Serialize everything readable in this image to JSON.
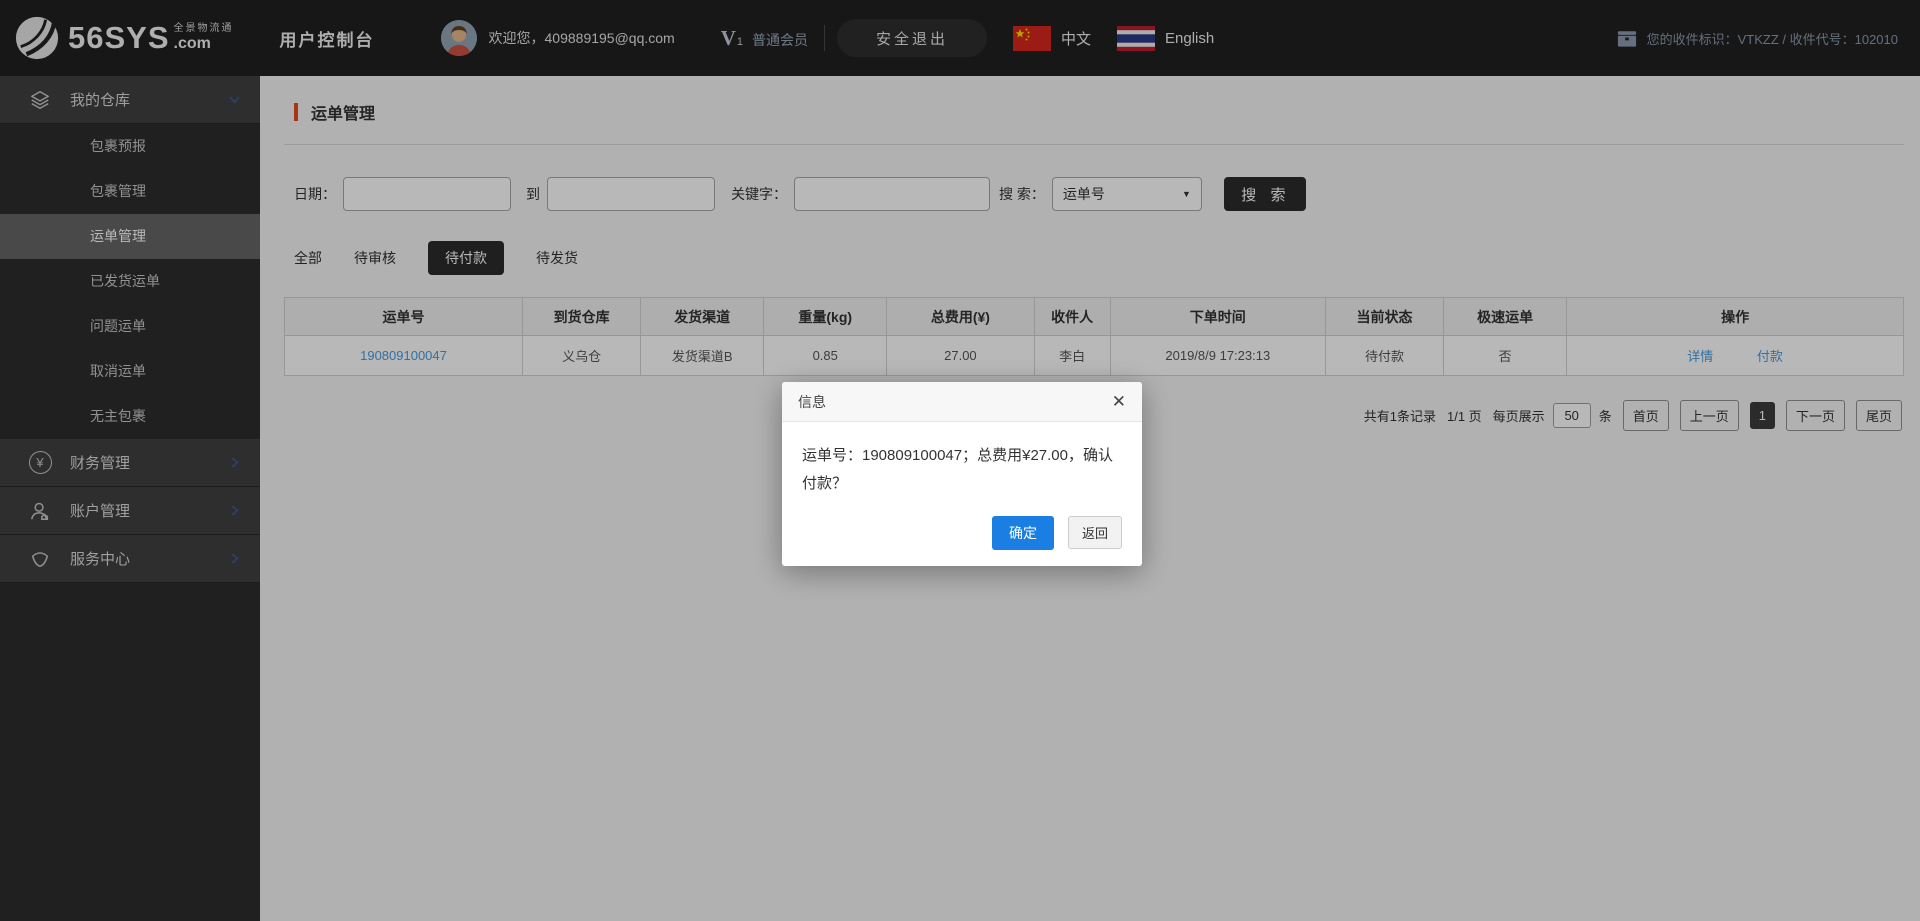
{
  "brand": {
    "name_main": "56SYS",
    "name_suffix": ".com",
    "tagline": "全景物流通",
    "console_title": "用户控制台"
  },
  "header": {
    "welcome": "欢迎您，409889195@qq.com",
    "member_badge_letter": "V",
    "member_badge_number": "1",
    "member_level": "普通会员",
    "logout_label": "安全退出",
    "lang_zh": "中文",
    "lang_en": "English",
    "receiver_info": "您的收件标识：VTKZZ / 收件代号：102010"
  },
  "sidebar": {
    "sections": [
      {
        "label": "我的仓库",
        "items": [
          "包裹预报",
          "包裹管理",
          "运单管理",
          "已发货运单",
          "问题运单",
          "取消运单",
          "无主包裹"
        ],
        "active_item": "运单管理"
      },
      {
        "label": "财务管理"
      },
      {
        "label": "账户管理"
      },
      {
        "label": "服务中心"
      }
    ]
  },
  "page": {
    "title": "运单管理"
  },
  "filters": {
    "date_label": "日期：",
    "to_label": "到",
    "keyword_label": "关键字：",
    "search_label": "搜 索：",
    "search_select_value": "运单号",
    "search_button": "搜 索",
    "date_from_value": "",
    "date_to_value": "",
    "keyword_value": ""
  },
  "tabs": [
    {
      "label": "全部"
    },
    {
      "label": "待审核"
    },
    {
      "label": "待付款",
      "active": true
    },
    {
      "label": "待发货"
    }
  ],
  "table": {
    "headers": [
      "运单号",
      "到货仓库",
      "发货渠道",
      "重量(kg)",
      "总费用(¥)",
      "收件人",
      "下单时间",
      "当前状态",
      "极速运单",
      "操作"
    ],
    "rows": [
      {
        "cells": [
          "190809100047",
          "义乌仓",
          "发货渠道B",
          "0.85",
          "27.00",
          "李白",
          "2019/8/9 17:23:13",
          "待付款",
          "否"
        ],
        "actions": [
          "详情",
          "付款"
        ]
      }
    ]
  },
  "pagination": {
    "summary": "共有1条记录",
    "page_indicator": "1/1 页",
    "per_page_label": "每页展示",
    "per_page_value": "50",
    "unit_label": "条",
    "first": "首页",
    "prev": "上一页",
    "current": "1",
    "next": "下一页",
    "last": "尾页"
  },
  "modal": {
    "title": "信息",
    "message": "运单号：190809100047；总费用¥27.00，确认付款？",
    "confirm": "确定",
    "cancel": "返回"
  },
  "icons": {
    "close": "✕",
    "caret_down": "▼",
    "yuan": "¥"
  },
  "colors": {
    "accent_red": "#e8491d",
    "link_blue": "#459ce2",
    "confirm_blue": "#1a7ee3"
  }
}
